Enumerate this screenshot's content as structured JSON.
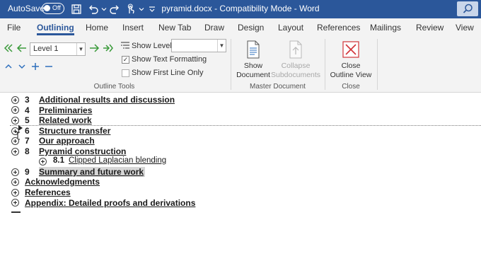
{
  "titlebar": {
    "autosave_label": "AutoSave",
    "autosave_state": "Off",
    "document_title": "pyramid.docx  -  Compatibility Mode  -  Word"
  },
  "tabs": [
    "File",
    "Outlining",
    "Home",
    "Insert",
    "New Tab",
    "Draw",
    "Design",
    "Layout",
    "References",
    "Mailings",
    "Review",
    "View"
  ],
  "active_tab": "Outlining",
  "ribbon": {
    "outline_tools": {
      "level_value": "Level 1",
      "show_level_label": "Show Level:",
      "show_level_value": "",
      "show_text_formatting_label": "Show Text Formatting",
      "show_text_formatting_checked": true,
      "show_first_line_only_label": "Show First Line Only",
      "show_first_line_only_checked": false,
      "group_label": "Outline Tools"
    },
    "master_document": {
      "show_document_line1": "Show",
      "show_document_line2": "Document",
      "collapse_subdocuments_line1": "Collapse",
      "collapse_subdocuments_line2": "Subdocuments",
      "group_label": "Master Document"
    },
    "close": {
      "close_outline_view_line1": "Close",
      "close_outline_view_line2": "Outline View",
      "group_label": "Close"
    }
  },
  "outline": [
    {
      "num": "3",
      "title": "Additional results and discussion",
      "level": 1
    },
    {
      "num": "4",
      "title": "Preliminaries",
      "level": 1
    },
    {
      "num": "5",
      "title": "Related work",
      "level": 1
    },
    {
      "num": "6",
      "title": "Structure transfer",
      "level": 1
    },
    {
      "num": "7",
      "title": "Our approach",
      "level": 1
    },
    {
      "num": "8",
      "title": "Pyramid construction",
      "level": 1
    },
    {
      "num": "8.1",
      "title": "Clipped Laplacian blending",
      "level": 2
    },
    {
      "num": "9",
      "title": "Summary and future work",
      "level": 1,
      "selected": true
    },
    {
      "num": "",
      "title": "Acknowledgments",
      "level": 1
    },
    {
      "num": "",
      "title": "References",
      "level": 1
    },
    {
      "num": "",
      "title": "Appendix: Detailed proofs and derivations",
      "level": 1
    }
  ],
  "colors": {
    "title_bar": "#2b579a",
    "ribbon_bg": "#f3f3f3",
    "arrow_green": "#3a9a3a",
    "arrow_blue": "#2e6fbd",
    "close_red": "#d13438",
    "selection": "#d6d6d6"
  }
}
